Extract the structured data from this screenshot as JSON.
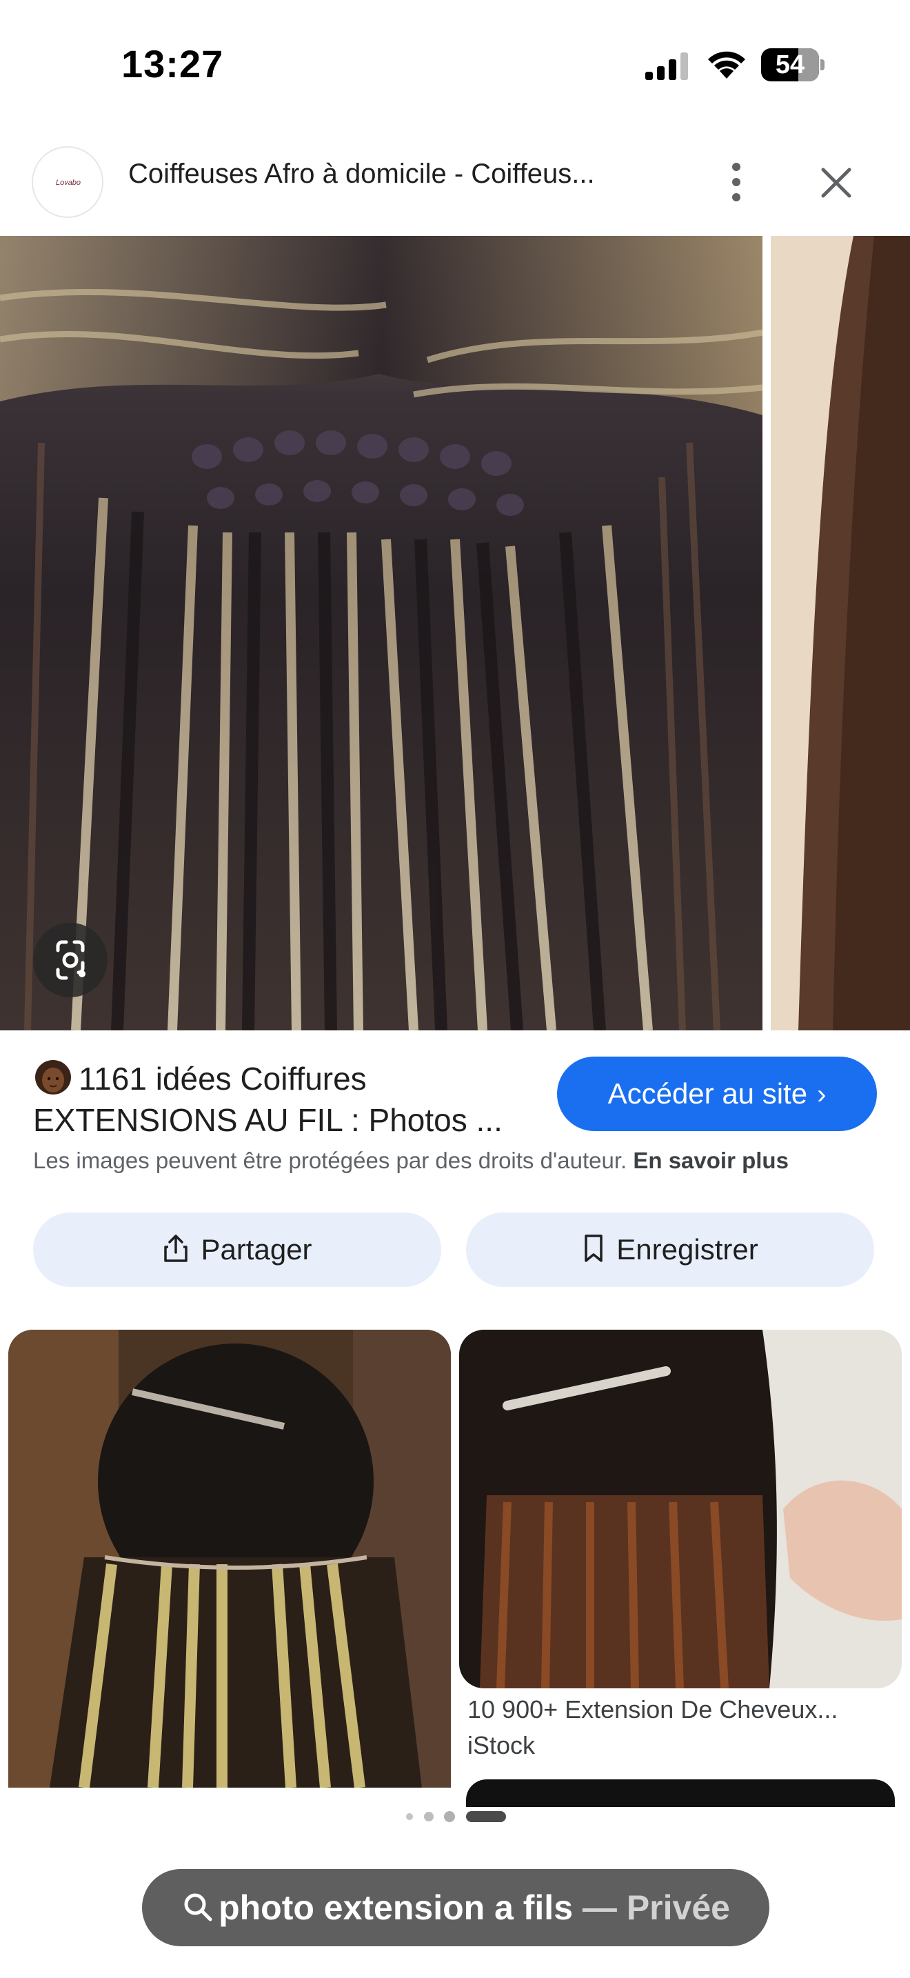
{
  "status_bar": {
    "time": "13:27",
    "battery": "54"
  },
  "header": {
    "site_title": "Coiffeuses Afro à domicile - Coiffeus...",
    "favicon_text": "Lovabo",
    "more_icon": "more-vert-icon",
    "close_icon": "close-icon"
  },
  "result": {
    "title_line1": "1161 idées Coiffures",
    "title_line2": "EXTENSIONS AU FIL : Photos ...",
    "visit_button": "Accéder au site",
    "copyright_text": "Les images peuvent être protégées par des droits d'auteur.",
    "learn_more": "En savoir plus",
    "share_button": "Partager",
    "save_button": "Enregistrer"
  },
  "related": [
    {
      "caption": "",
      "source": ""
    },
    {
      "caption": "10 900+ Extension De Cheveux...",
      "source": "iStock"
    }
  ],
  "search": {
    "query": "photo extension a fils",
    "mode": "— Privée"
  },
  "colors": {
    "accent": "#1a6ff0",
    "pill": "#5f5f5f",
    "action_bg": "#e8effb"
  }
}
